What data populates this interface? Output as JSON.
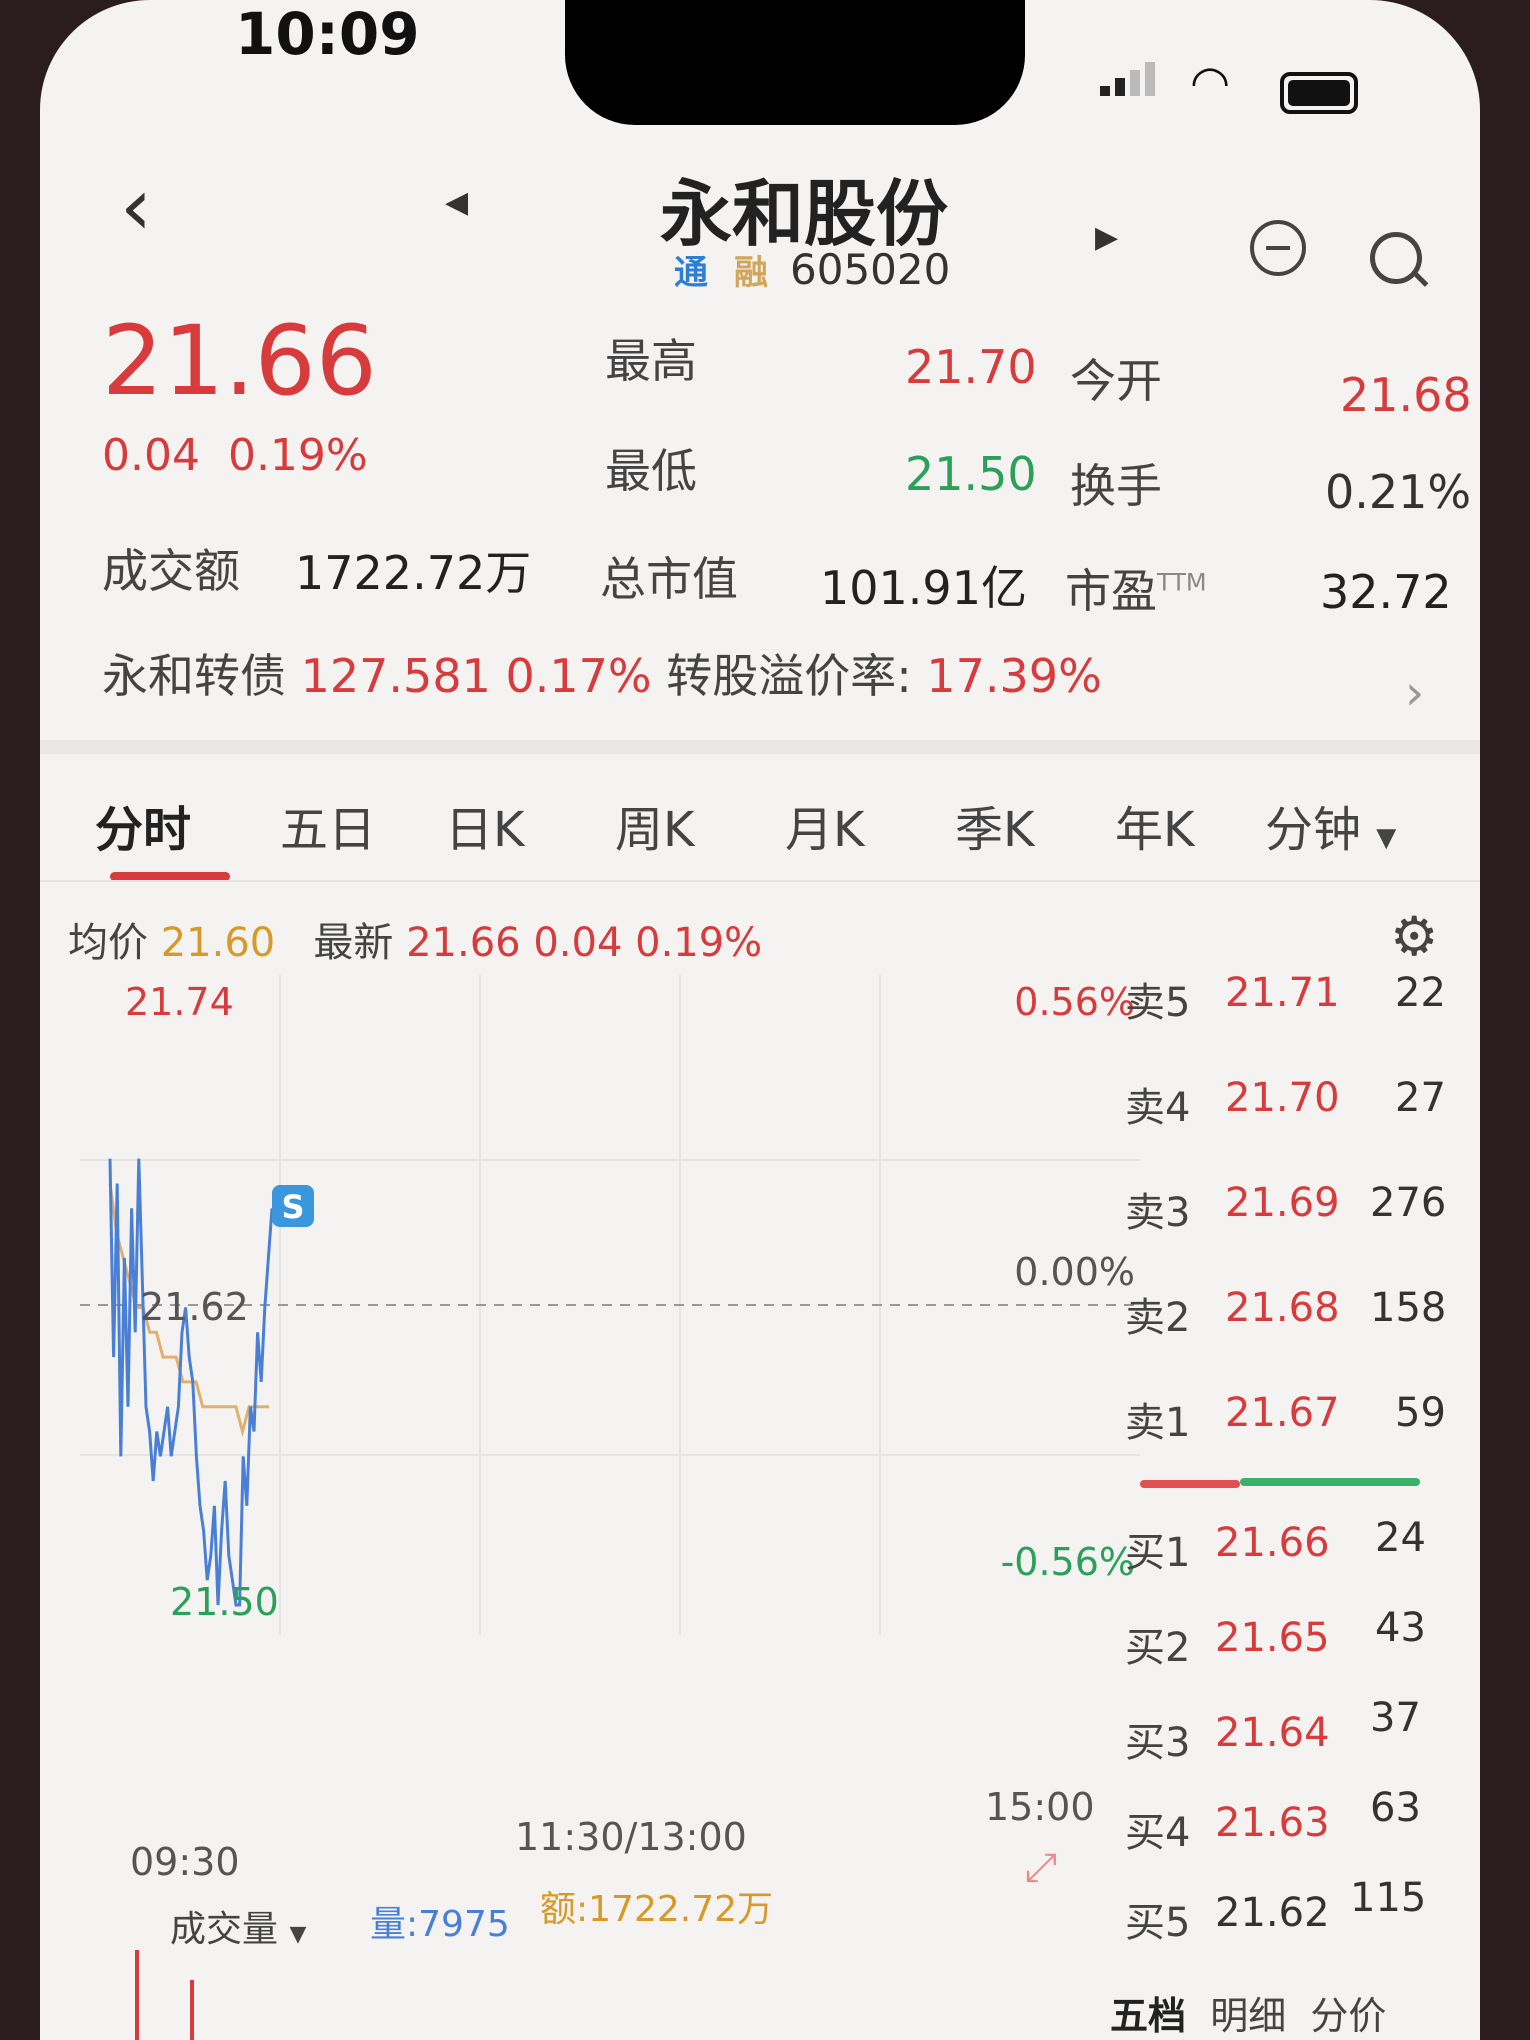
{
  "status_bar": {
    "time": "10:09"
  },
  "header": {
    "title": "永和股份",
    "badge_tong": "通",
    "badge_rong": "融",
    "code": "605020"
  },
  "quote": {
    "price": "21.66",
    "change": "0.04",
    "change_pct": "0.19%",
    "high_label": "最高",
    "high": "21.70",
    "open_label": "今开",
    "open": "21.68",
    "low_label": "最低",
    "low": "21.50",
    "turnover_label": "换手",
    "turnover": "0.21%",
    "amount_label": "成交额",
    "amount": "1722.72万",
    "mcap_label": "总市值",
    "mcap": "101.91亿",
    "pe_label": "市盈",
    "pe_sup": "TTM",
    "pe": "32.72"
  },
  "bond": {
    "name": "永和转债",
    "price": "127.581",
    "pct": "0.17%",
    "premium_label": "转股溢价率:",
    "premium": "17.39%"
  },
  "tabs": [
    "分时",
    "五日",
    "日K",
    "周K",
    "月K",
    "季K",
    "年K",
    "分钟"
  ],
  "chart_info": {
    "avg_label": "均价",
    "avg": "21.60",
    "latest_label": "最新",
    "latest": "21.66 0.04 0.19%"
  },
  "chart_data": {
    "type": "line",
    "y_high": "21.74",
    "y_mid": "21.62",
    "y_low": "21.50",
    "pct_high": "0.56%",
    "pct_mid": "0.00%",
    "pct_low": "-0.56%",
    "x_start": "09:30",
    "x_mid": "11:30/13:00",
    "x_end": "15:00",
    "ylim": [
      21.5,
      21.74
    ],
    "marker": "S",
    "series": [
      {
        "values": [
          21.68,
          21.6,
          21.67,
          21.56,
          21.64,
          21.58,
          21.66,
          21.61,
          21.68,
          21.63,
          21.58,
          21.57,
          21.55,
          21.57,
          21.56,
          21.57,
          21.58,
          21.56,
          21.57,
          21.58,
          21.61,
          21.62,
          21.6,
          21.59,
          21.56,
          21.54,
          21.53,
          21.51,
          21.52,
          21.54,
          21.5,
          21.53,
          21.55,
          21.52,
          21.51,
          21.5,
          21.5,
          21.56,
          21.54,
          21.58,
          21.57,
          21.61,
          21.59,
          21.62,
          21.64,
          21.66
        ]
      },
      {
        "values": [
          21.67,
          21.65,
          21.64,
          21.63,
          21.62,
          21.62,
          21.61,
          21.61,
          21.6,
          21.6,
          21.6,
          21.59,
          21.59,
          21.59,
          21.58,
          21.58,
          21.58,
          21.58,
          21.58,
          21.58,
          21.57,
          21.58,
          21.58,
          21.58,
          21.58
        ]
      }
    ]
  },
  "order_book": {
    "asks": [
      {
        "label": "卖5",
        "price": "21.71",
        "vol": "22"
      },
      {
        "label": "卖4",
        "price": "21.70",
        "vol": "27"
      },
      {
        "label": "卖3",
        "price": "21.69",
        "vol": "276"
      },
      {
        "label": "卖2",
        "price": "21.68",
        "vol": "158"
      },
      {
        "label": "卖1",
        "price": "21.67",
        "vol": "59"
      }
    ],
    "bids": [
      {
        "label": "买1",
        "price": "21.66",
        "vol": "24"
      },
      {
        "label": "买2",
        "price": "21.65",
        "vol": "43"
      },
      {
        "label": "买3",
        "price": "21.64",
        "vol": "37"
      },
      {
        "label": "买4",
        "price": "21.63",
        "vol": "63"
      },
      {
        "label": "买5",
        "price": "21.62",
        "vol": "115"
      }
    ],
    "tabs": [
      "五档",
      "明细",
      "分价"
    ]
  },
  "volume_bar": {
    "label": "成交量",
    "vol": "量:7975",
    "amt": "额:1722.72万"
  }
}
